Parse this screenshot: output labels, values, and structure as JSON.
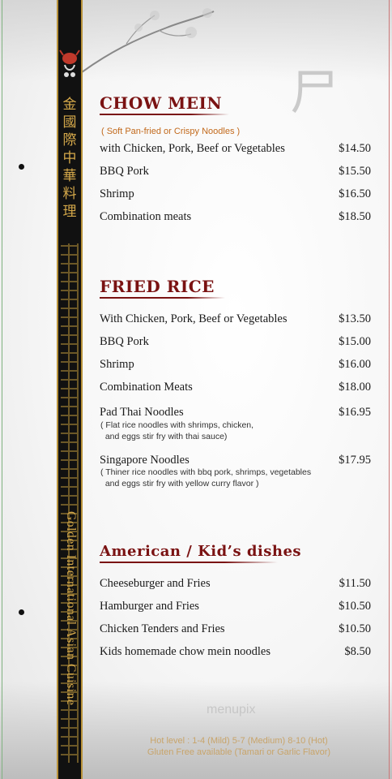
{
  "sidebar": {
    "chinese_name": "金國際中華料理",
    "english_name": "Golden International Asian Cuisine"
  },
  "sections": {
    "chow_mein": {
      "title": "CHOW MEIN",
      "note": "( Soft Pan-fried or Crispy Noodles )",
      "items": [
        {
          "name": "with Chicken, Pork, Beef or Vegetables",
          "price": "$14.50"
        },
        {
          "name": "BBQ Pork",
          "price": "$15.50"
        },
        {
          "name": "Shrimp",
          "price": "$16.50"
        },
        {
          "name": "Combination meats",
          "price": "$18.50"
        }
      ]
    },
    "fried_rice": {
      "title": "FRIED RICE",
      "items": [
        {
          "name": "With Chicken, Pork, Beef or Vegetables",
          "price": "$13.50"
        },
        {
          "name": "BBQ Pork",
          "price": "$15.00"
        },
        {
          "name": "Shrimp",
          "price": "$16.00"
        },
        {
          "name": "Combination Meats",
          "price": "$18.00"
        },
        {
          "name": "Pad Thai Noodles",
          "price": "$16.95",
          "desc": "( Flat rice noodles with shrimps, chicken,\n  and eggs stir fry with thai sauce)"
        },
        {
          "name": "Singapore Noodles",
          "price": "$17.95",
          "desc": "( Thiner rice noodles with bbq pork, shrimps, vegetables\n  and eggs stir fry with yellow curry flavor )"
        }
      ]
    },
    "american": {
      "title": "American / Kid’s dishes",
      "items": [
        {
          "name": "Cheeseburger and Fries",
          "price": "$11.50"
        },
        {
          "name": "Hamburger and Fries",
          "price": "$10.50"
        },
        {
          "name": "Chicken Tenders and Fries",
          "price": "$10.50"
        },
        {
          "name": "Kids homemade chow mein noodles",
          "price": "$8.50"
        }
      ]
    }
  },
  "footer": {
    "hot_level": "Hot level : 1-4 (Mild) 5-7 (Medium) 8-10 (Hot)",
    "gluten": "Gluten Free available (Tamari or Garlic Flavor)"
  },
  "watermark": "menupix",
  "colors": {
    "title": "#7a1212",
    "gold": "#d4a84a",
    "note": "#c2691b"
  }
}
